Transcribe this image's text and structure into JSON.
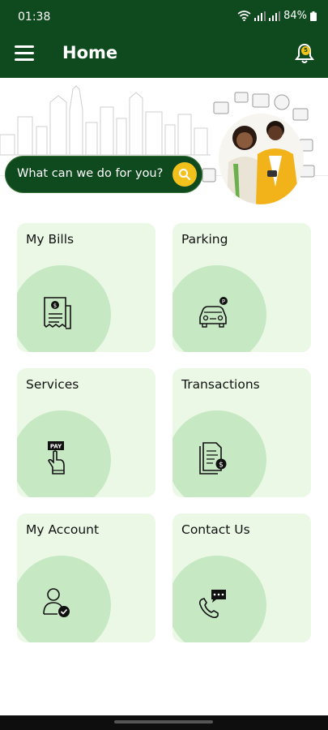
{
  "status": {
    "time": "01:38",
    "battery": "84%"
  },
  "header": {
    "title": "Home",
    "notification_count": "5"
  },
  "hero": {
    "search_prompt": "What can we do for you?"
  },
  "tiles": [
    {
      "label": "My Bills",
      "icon": "bill-receipt-icon"
    },
    {
      "label": "Parking",
      "icon": "car-parking-icon"
    },
    {
      "label": "Services",
      "icon": "pay-hand-icon"
    },
    {
      "label": "Transactions",
      "icon": "document-dollar-icon"
    },
    {
      "label": "My Account",
      "icon": "user-check-icon"
    },
    {
      "label": "Contact Us",
      "icon": "phone-chat-icon"
    }
  ],
  "colors": {
    "primary": "#0f4a1e",
    "accent": "#f2c11c",
    "tile_bg": "#ebf8e6",
    "tile_blob": "#c6e8c3"
  }
}
